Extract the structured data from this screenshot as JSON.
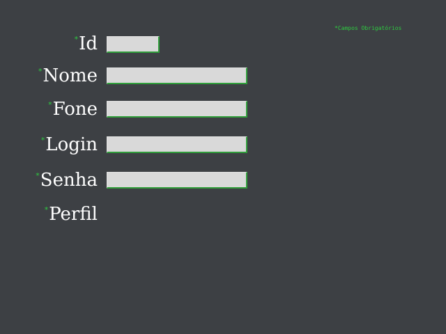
{
  "required_note": "*Campos Obrigatórios",
  "required_mark": "*",
  "colors": {
    "background": "#3d4044",
    "label": "#ffffff",
    "required": "#2ecc40",
    "input_bg": "#d9d9d9",
    "input_shadow": "#2f9e3a"
  },
  "fields": {
    "id": {
      "label": "Id",
      "value": ""
    },
    "nome": {
      "label": "Nome",
      "value": ""
    },
    "fone": {
      "label": "Fone",
      "value": ""
    },
    "login": {
      "label": "Login",
      "value": ""
    },
    "senha": {
      "label": "Senha",
      "value": ""
    },
    "perfil": {
      "label": "Perfil"
    }
  }
}
